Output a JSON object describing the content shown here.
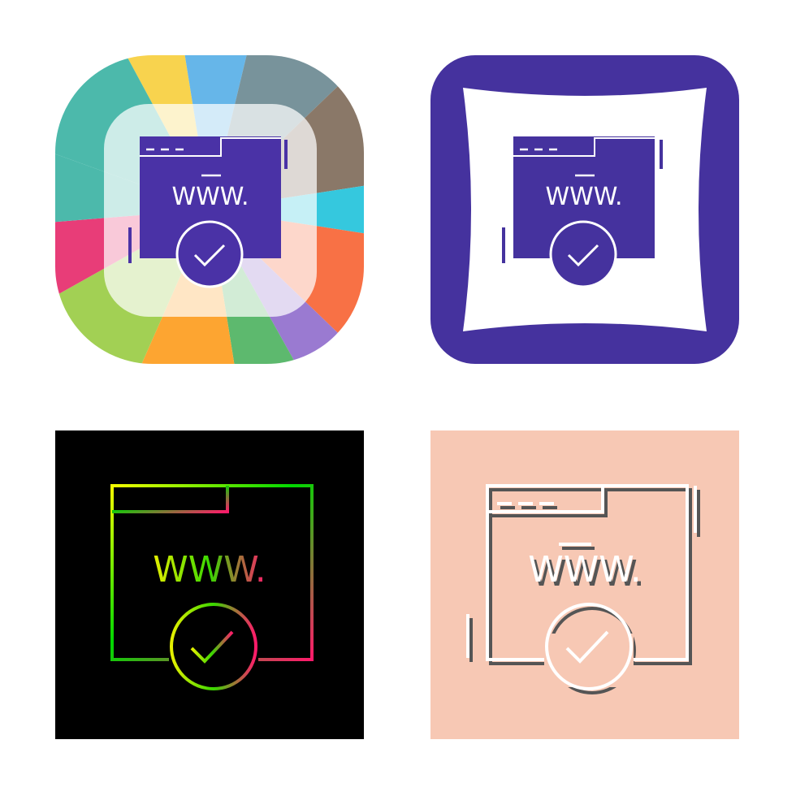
{
  "icon_set": {
    "subject": "website-verified-icon",
    "url_text": "WWW.",
    "variants": [
      {
        "style": "colorful-glyph",
        "accent": "#4a32a6"
      },
      {
        "style": "glyph-on-pillow",
        "accent": "#45329e",
        "background": "#45329e"
      },
      {
        "style": "gradient-line",
        "background": "#000000",
        "gradient": [
          "#f5ff00",
          "#00d800",
          "#ff1a6b"
        ]
      },
      {
        "style": "line-with-shadow",
        "background": "#f7c8b4",
        "stroke": "#ffffff",
        "shadow": "#555555"
      }
    ]
  }
}
